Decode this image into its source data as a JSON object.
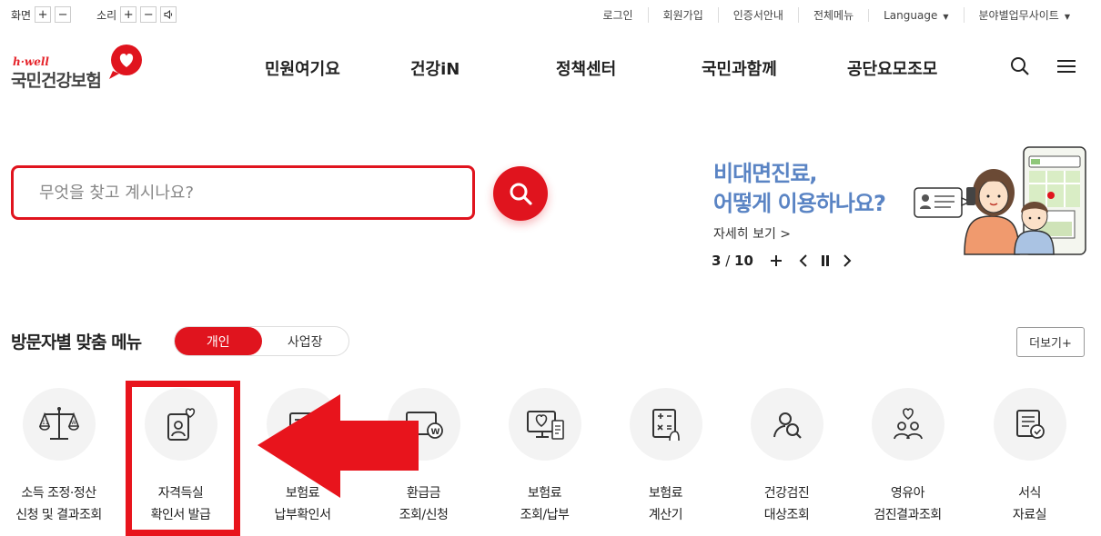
{
  "util": {
    "screen_label": "화면",
    "sound_label": "소리",
    "plus": "+",
    "minus": "−",
    "links": [
      "로그인",
      "회원가입",
      "인증서안내",
      "전체메뉴"
    ],
    "language": "Language",
    "sites": "분야별업무사이트"
  },
  "logo": {
    "eng": "h·well",
    "kr": "국민건강보험"
  },
  "gnb": [
    "민원여기요",
    "건강iN",
    "정책센터",
    "국민과함께",
    "공단요모조모"
  ],
  "search": {
    "placeholder": "무엇을 찾고 계시나요?"
  },
  "banner": {
    "line1": "비대면진료,",
    "line2": "어떻게 이용하나요?",
    "more": "자세히 보기 >",
    "current": "3",
    "total": "10",
    "sep": " / "
  },
  "menu_section": {
    "title": "방문자별 맞춤 메뉴",
    "tab_on": "개인",
    "tab_off": "사업장",
    "more": "더보기+"
  },
  "menu_items": [
    {
      "l1": "소득 조정·정산",
      "l2": "신청 및 결과조회",
      "icon": "scale-icon"
    },
    {
      "l1": "자격득실",
      "l2": "확인서 발급",
      "icon": "id-card-heart-icon"
    },
    {
      "l1": "보험료",
      "l2": "납부확인서",
      "icon": "receipt-icon"
    },
    {
      "l1": "환급금",
      "l2": "조회/신청",
      "icon": "refund-icon"
    },
    {
      "l1": "보험료",
      "l2": "조회/납부",
      "icon": "monitor-heart-icon"
    },
    {
      "l1": "보험료",
      "l2": "계산기",
      "icon": "calculator-icon"
    },
    {
      "l1": "건강검진",
      "l2": "대상조회",
      "icon": "person-search-icon"
    },
    {
      "l1": "영유아",
      "l2": "검진결과조회",
      "icon": "family-heart-icon"
    },
    {
      "l1": "서식",
      "l2": "자료실",
      "icon": "document-check-icon"
    }
  ],
  "colors": {
    "brand_red": "#e0141e",
    "banner_blue": "#5a84c4"
  }
}
